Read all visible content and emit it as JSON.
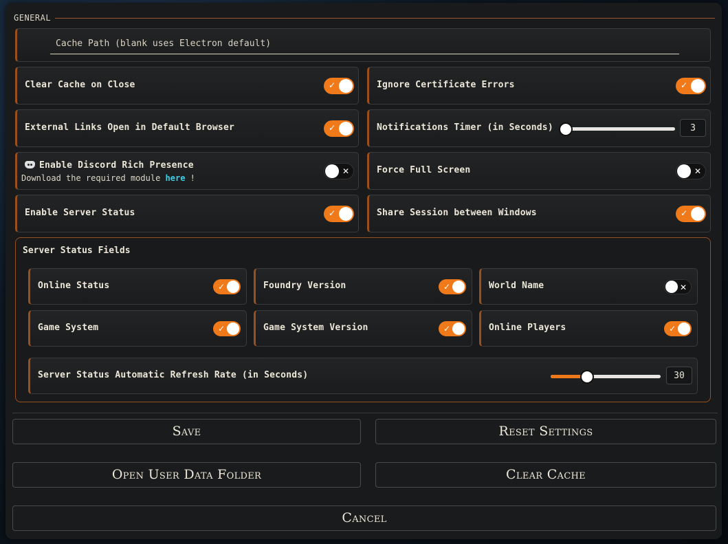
{
  "general": {
    "legend": "GENERAL",
    "cache_path_placeholder": "Cache Path (blank uses Electron default)"
  },
  "settings": {
    "clear_cache": {
      "label": "Clear Cache on Close",
      "on": true
    },
    "ignore_cert": {
      "label": "Ignore Certificate Errors",
      "on": true
    },
    "external_links": {
      "label": "External Links Open in Default Browser",
      "on": true
    },
    "notifications_timer": {
      "label": "Notifications Timer (in Seconds)",
      "value": "3",
      "fraction": 0.0
    },
    "discord": {
      "label": "Enable Discord Rich Presence",
      "note_prefix": "Download the required module",
      "note_link": "here",
      "note_suffix": "!",
      "on": false
    },
    "full_screen": {
      "label": "Force Full Screen",
      "on": false
    },
    "server_status": {
      "label": "Enable Server Status",
      "on": true
    },
    "share_session": {
      "label": "Share Session between Windows",
      "on": true
    }
  },
  "server_fields": {
    "title": "Server Status Fields",
    "online_status": {
      "label": "Online Status",
      "on": true
    },
    "foundry_version": {
      "label": "Foundry Version",
      "on": true
    },
    "world_name": {
      "label": "World Name",
      "on": false
    },
    "game_system": {
      "label": "Game System",
      "on": true
    },
    "game_system_version": {
      "label": "Game System Version",
      "on": true
    },
    "online_players": {
      "label": "Online Players",
      "on": true
    },
    "refresh_rate": {
      "label": "Server Status Automatic Refresh Rate (in Seconds)",
      "value": "30",
      "fraction": 0.33
    }
  },
  "buttons": {
    "save": "Save",
    "reset": "Reset Settings",
    "open_folder": "Open User Data Folder",
    "clear_cache": "Clear Cache",
    "cancel": "Cancel"
  },
  "icons": {
    "check": "check-icon",
    "cross": "x-icon",
    "discord": "discord-icon"
  },
  "colors": {
    "accent": "#f07a1a",
    "border_accent": "#9a4f1f",
    "link": "#3ad0e8"
  }
}
